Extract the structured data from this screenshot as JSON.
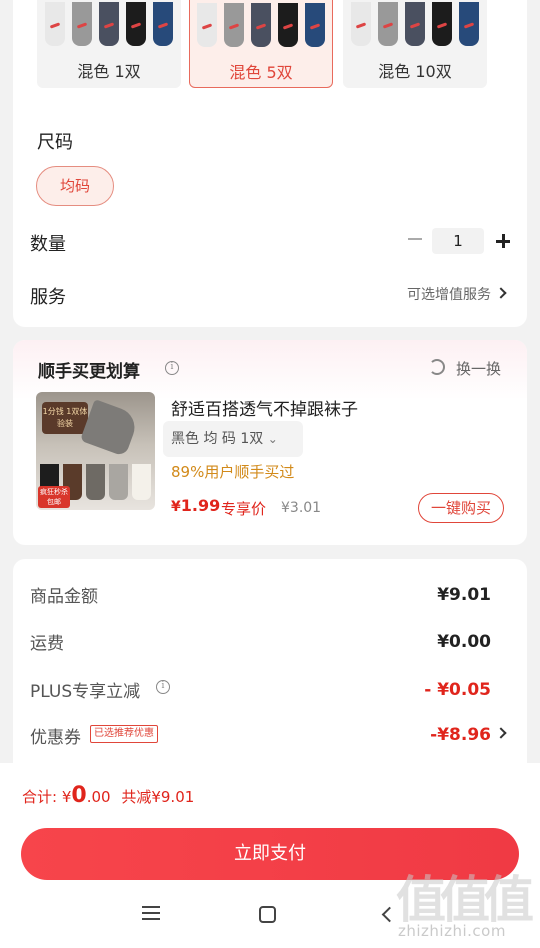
{
  "spec": {
    "variants": [
      {
        "label": "混色 1双",
        "selected": false
      },
      {
        "label": "混色 5双",
        "selected": true
      },
      {
        "label": "混色 10双",
        "selected": false
      }
    ],
    "size_label": "尺码",
    "size_option": "均码",
    "quantity_label": "数量",
    "quantity_value": "1",
    "service_label": "服务",
    "service_value": "可选增值服务"
  },
  "recommend": {
    "title": "顺手买更划算",
    "swap_label": "换一换",
    "product_name": "舒适百搭透气不掉跟袜子",
    "product_spec": "黑色   均 码 1双",
    "bought_text": "89%用户顺手买过",
    "price_currency": "¥",
    "price": "1.99",
    "price_tag": "专享价",
    "orig_price": "¥3.01",
    "buy_label": "一键购买",
    "img_badge_top": "1分钱 1双体验装",
    "img_badge_bottom": "疯狂秒杀 包邮"
  },
  "summary": {
    "goods_label": "商品金额",
    "goods_value": "¥9.01",
    "shipping_label": "运费",
    "shipping_value": "¥0.00",
    "plus_label": "PLUS专享立减",
    "plus_value": "- ¥0.05",
    "coupon_label": "优惠券",
    "coupon_tag": "已选推荐优惠",
    "coupon_value": "-¥8.96"
  },
  "bottom": {
    "total_label": "合计:",
    "total_currency": "¥",
    "total_int": "0",
    "total_dec": ".00",
    "saved_text": "共减¥9.01",
    "pay_label": "立即支付"
  },
  "watermark": {
    "logo": "值值值",
    "url": "zhizhizhi.com"
  },
  "colors": {
    "accent": "#e0251c",
    "pay_button": "#f7454b",
    "bought_text": "#d28a1a"
  }
}
